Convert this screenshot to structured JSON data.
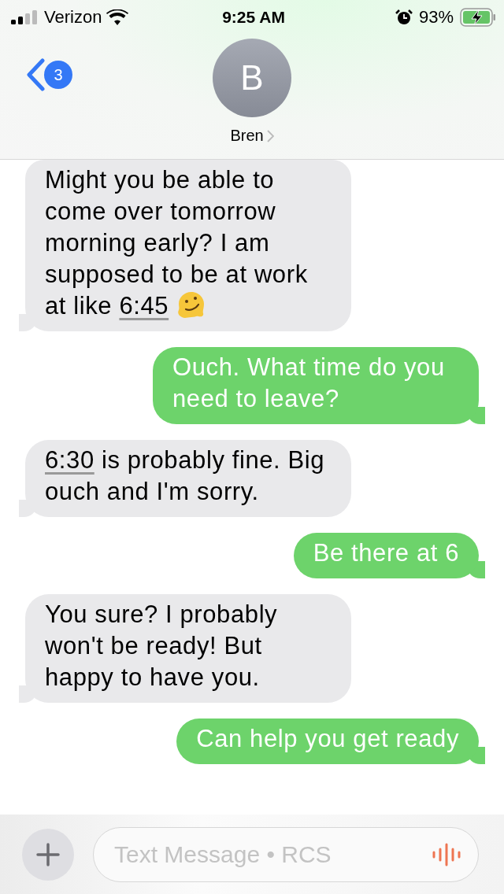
{
  "status_bar": {
    "carrier": "Verizon",
    "time": "9:25 AM",
    "battery": "93%",
    "charging": true
  },
  "header": {
    "unread_count": "3",
    "avatar_initial": "B",
    "contact_name": "Bren"
  },
  "messages": [
    {
      "sent": false,
      "parts": [
        {
          "kind": "text",
          "text": "Might you be able to come over tomorrow morning early? I am supposed to be at work at like "
        },
        {
          "kind": "link",
          "text": "6:45"
        },
        {
          "kind": "emoji"
        }
      ]
    },
    {
      "sent": true,
      "parts": [
        {
          "kind": "text",
          "text": "Ouch. What time do you need to leave?"
        }
      ]
    },
    {
      "sent": false,
      "parts": [
        {
          "kind": "link",
          "text": "6:30"
        },
        {
          "kind": "text",
          "text": " is probably fine. Big ouch and I'm sorry."
        }
      ]
    },
    {
      "sent": true,
      "parts": [
        {
          "kind": "text",
          "text": "Be there at 6"
        }
      ]
    },
    {
      "sent": false,
      "parts": [
        {
          "kind": "text",
          "text": "You sure? I probably won't be ready! But happy to have you."
        }
      ]
    },
    {
      "sent": true,
      "parts": [
        {
          "kind": "text",
          "text": "Can help you get ready"
        }
      ]
    }
  ],
  "composer": {
    "placeholder": "Text Message • RCS"
  }
}
